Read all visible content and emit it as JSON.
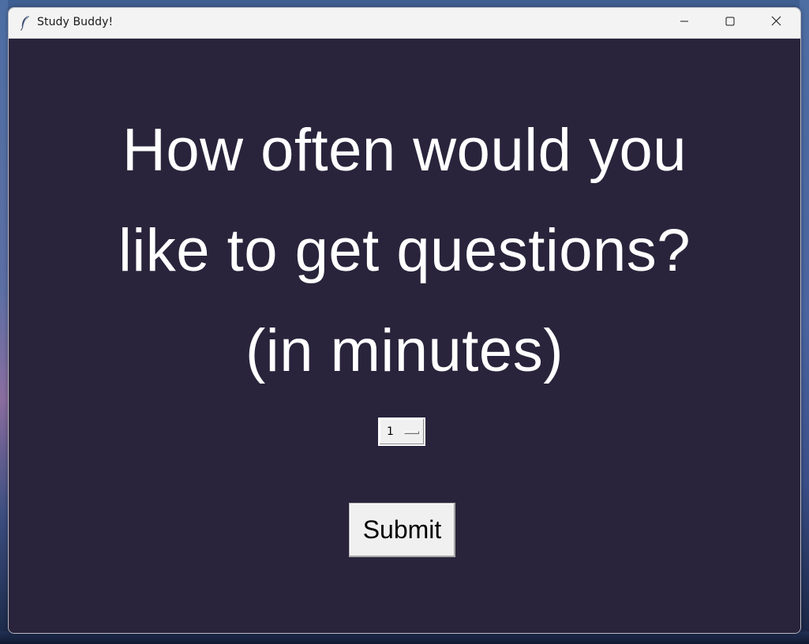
{
  "window": {
    "title": "Study Buddy!",
    "icon": "feather-icon",
    "controls": {
      "minimize_icon": "minimize-icon",
      "maximize_icon": "maximize-icon",
      "close_icon": "close-icon"
    }
  },
  "prompt": {
    "line1": "How often would you",
    "line2": "like to get questions?",
    "line3": "(in minutes)"
  },
  "interval_select": {
    "selected_value": "1"
  },
  "submit": {
    "label": "Submit"
  },
  "colors": {
    "background": "#29243b",
    "text": "#ffffff",
    "titlebar": "#f3f3f3",
    "button_face": "#f0f0f0"
  }
}
